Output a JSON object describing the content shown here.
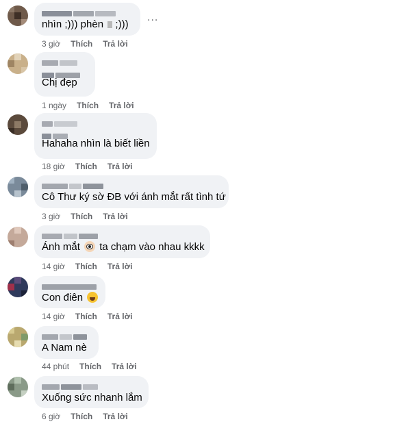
{
  "more_label": "...",
  "comments": [
    {
      "text_before": "nhìn ;))) phèn",
      "text_after": ";)))",
      "time": "3 giờ",
      "like": "Thích",
      "reply": "Trả lời"
    },
    {
      "text": "Chị đẹp",
      "time": "1 ngày",
      "like": "Thích",
      "reply": "Trả lời"
    },
    {
      "text": "Hahaha nhìn là biết liền",
      "time": "18 giờ",
      "like": "Thích",
      "reply": "Trả lời"
    },
    {
      "text": "Cô Thư ký sờ ĐB với ánh mắt rất tình tứ",
      "time": "3 giờ",
      "like": "Thích",
      "reply": "Trả lời"
    },
    {
      "text_before": "Ánh mắt",
      "emoji": "eye-emoji",
      "text_after": "ta chạm vào nhau kkkk",
      "time": "14 giờ",
      "like": "Thích",
      "reply": "Trả lời"
    },
    {
      "text_before": "Con điên",
      "emoji": "rolling-laughing-emoji",
      "time": "14 giờ",
      "like": "Thích",
      "reply": "Trả lời"
    },
    {
      "text": "A Nam nè",
      "time": "44 phút",
      "like": "Thích",
      "reply": "Trả lời"
    },
    {
      "text": "Xuống sức nhanh lắm",
      "time": "6 giờ",
      "like": "Thích",
      "reply": "Trả lời"
    }
  ]
}
